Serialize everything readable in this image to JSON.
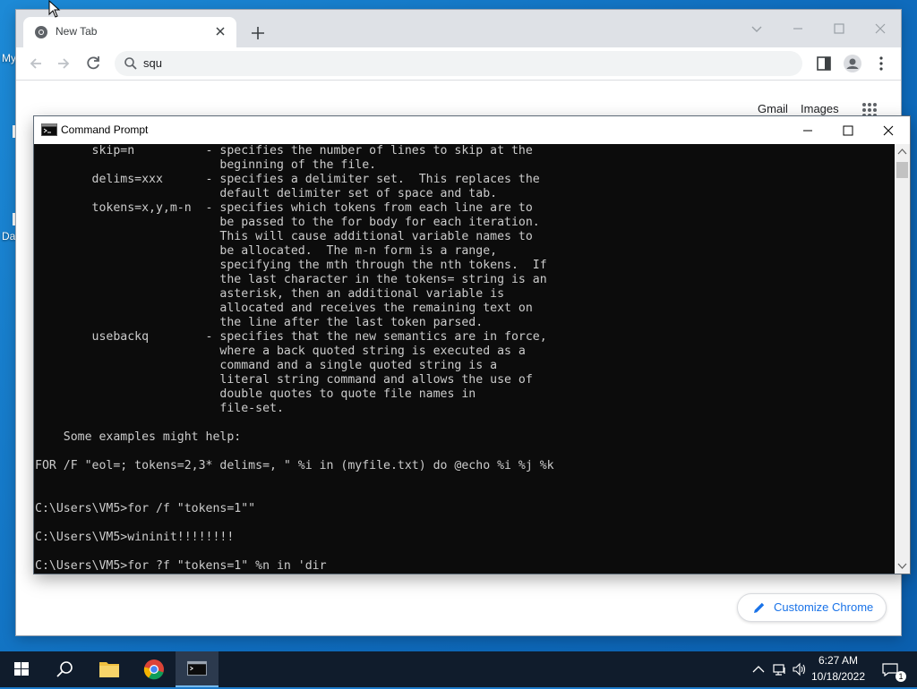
{
  "desktop": {
    "labels": [
      "My",
      "Da"
    ]
  },
  "chrome": {
    "tab": {
      "title": "New Tab"
    },
    "omnibox": {
      "text": "squ"
    },
    "links": {
      "gmail": "Gmail",
      "images": "Images"
    },
    "customize_label": "Customize Chrome"
  },
  "cmd": {
    "title": "Command Prompt",
    "console_text": "        skip=n          - specifies the number of lines to skip at the\n                          beginning of the file.\n        delims=xxx      - specifies a delimiter set.  This replaces the\n                          default delimiter set of space and tab.\n        tokens=x,y,m-n  - specifies which tokens from each line are to\n                          be passed to the for body for each iteration.\n                          This will cause additional variable names to\n                          be allocated.  The m-n form is a range,\n                          specifying the mth through the nth tokens.  If\n                          the last character in the tokens= string is an\n                          asterisk, then an additional variable is\n                          allocated and receives the remaining text on\n                          the line after the last token parsed.\n        usebackq        - specifies that the new semantics are in force,\n                          where a back quoted string is executed as a\n                          command and a single quoted string is a\n                          literal string command and allows the use of\n                          double quotes to quote file names in\n                          file-set.\n\n    Some examples might help:\n\nFOR /F \"eol=; tokens=2,3* delims=, \" %i in (myfile.txt) do @echo %i %j %k\n\n\nC:\\Users\\VM5>for /f \"tokens=1\"\"\n\nC:\\Users\\VM5>wininit!!!!!!!!\n\nC:\\Users\\VM5>for ?f \"tokens=1\" %n in 'dir"
  },
  "taskbar": {
    "time": "6:27 AM",
    "date": "10/18/2022",
    "notification_count": "1"
  },
  "colors": {
    "desktop": "#0f6cbd",
    "taskbar": "#101c2c",
    "chrome_tabstrip": "#dee1e6",
    "console_bg": "#0c0c0c",
    "console_fg": "#cccccc",
    "link_blue": "#1a73e8"
  }
}
